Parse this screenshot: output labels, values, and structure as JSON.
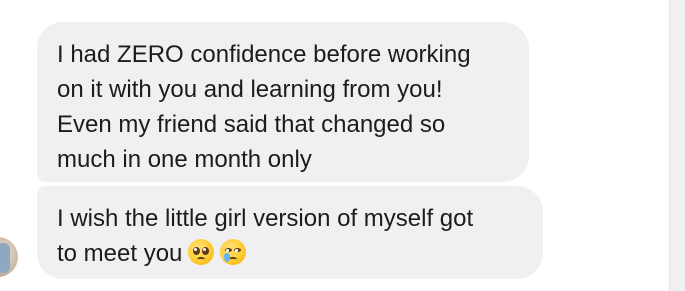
{
  "conversation": {
    "messages": [
      {
        "lines": [
          "I had ZERO confidence before working",
          "on it with you and learning from you!",
          "Even my friend said that changed so",
          "much in one month only"
        ]
      },
      {
        "lines": [
          "I wish the little girl version of myself got",
          "to meet you"
        ],
        "emojis": [
          "pleading-face-icon",
          "crying-face-icon"
        ]
      }
    ]
  }
}
